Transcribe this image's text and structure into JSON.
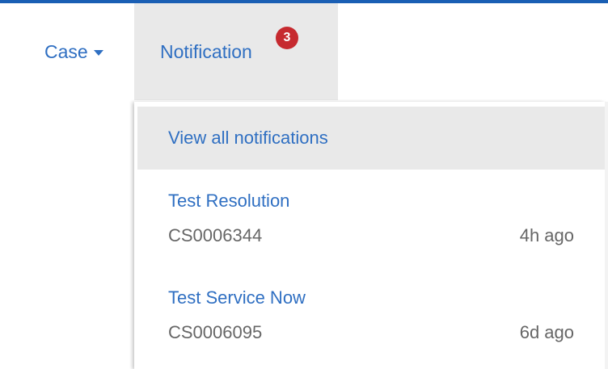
{
  "nav": {
    "case_label": "Case",
    "notification_label": "Notification",
    "notification_count": "3"
  },
  "dropdown": {
    "view_all_label": "View all notifications",
    "items": [
      {
        "title": "Test Resolution",
        "case_id": "CS0006344",
        "time": "4h ago"
      },
      {
        "title": "Test Service Now",
        "case_id": "CS0006095",
        "time": "6d ago"
      }
    ]
  },
  "colors": {
    "accent": "#2f6fc2",
    "top_border": "#1a5fb4",
    "badge": "#c62a2f",
    "hover_bg": "#e9e9e9",
    "muted_text": "#666666"
  }
}
